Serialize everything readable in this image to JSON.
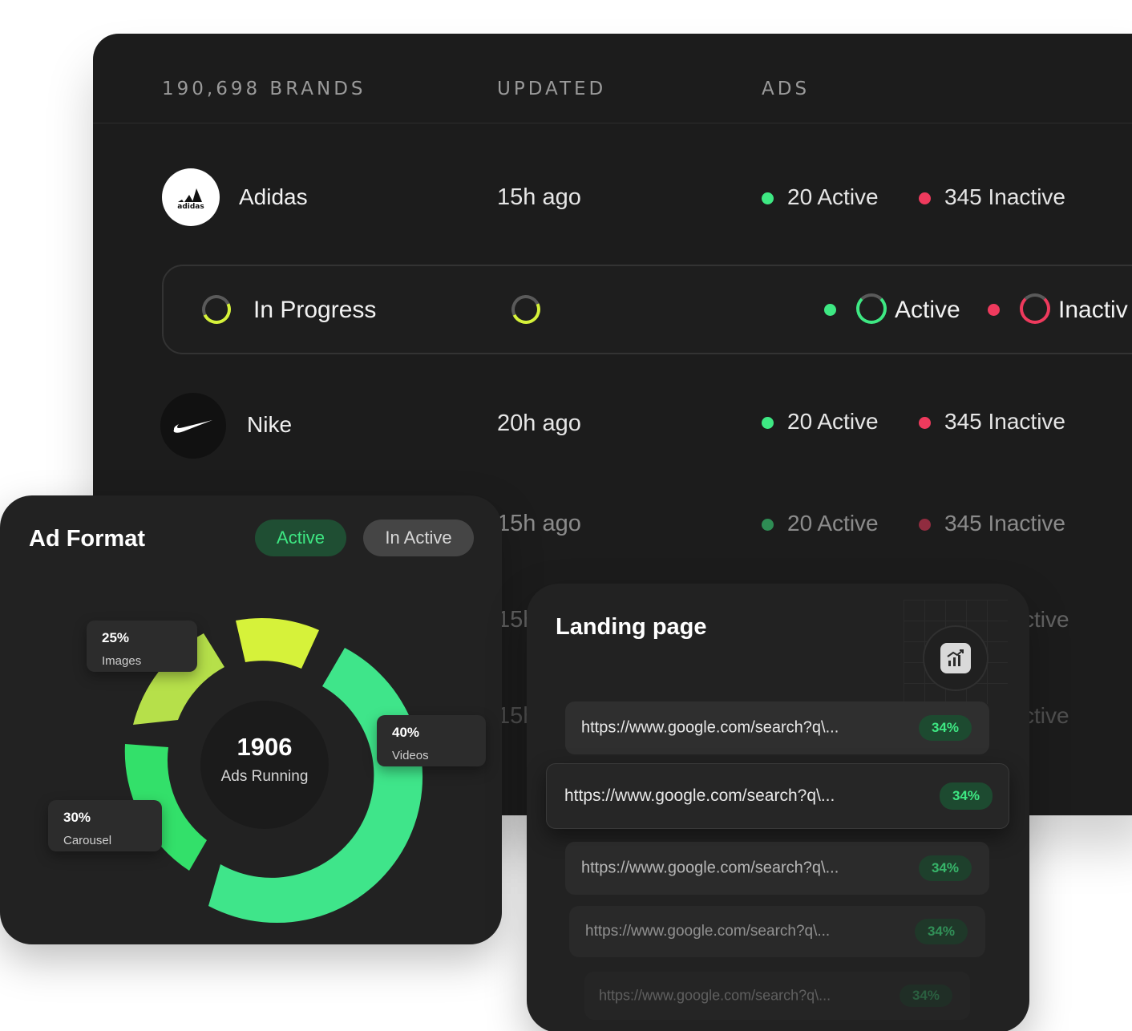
{
  "table": {
    "headers": {
      "brands": "190,698 BRANDS",
      "updated": "UPDATED",
      "ads": "ADS"
    },
    "rows": [
      {
        "brand": "Adidas",
        "logo": "adidas-logo-icon",
        "updated": "15h ago",
        "active": "20 Active",
        "inactive": "345 Inactive"
      },
      {
        "brand": "Nike",
        "logo": "nike-swoosh-icon",
        "updated": "20h ago",
        "active": "20 Active",
        "inactive": "345 Inactive"
      },
      {
        "brand": "",
        "updated": "15h ago",
        "active": "20 Active",
        "inactive": "345 Inactive"
      },
      {
        "updated": "15h",
        "inactive": "ctive"
      },
      {
        "updated": "15h",
        "inactive": "ctive"
      }
    ],
    "progress": {
      "label": "In Progress",
      "active_label": "Active",
      "inactive_label": "Inactiv"
    }
  },
  "ad_format": {
    "title": "Ad Format",
    "filters": {
      "active": "Active",
      "inactive": "In Active"
    },
    "center": {
      "value": "1906",
      "label": "Ads Running"
    },
    "segments": [
      {
        "pct": "25%",
        "label": "Images"
      },
      {
        "pct": "40%",
        "label": "Videos"
      },
      {
        "pct": "30%",
        "label": "Carousel"
      }
    ]
  },
  "landing_page": {
    "title": "Landing page",
    "icon": "chart-icon",
    "urls": [
      {
        "url": "https://www.google.com/search?q\\...",
        "pct": "34%"
      },
      {
        "url": "https://www.google.com/search?q\\...",
        "pct": "34%"
      },
      {
        "url": "https://www.google.com/search?q\\...",
        "pct": "34%"
      },
      {
        "url": "https://www.google.com/search?q\\...",
        "pct": "34%"
      },
      {
        "url": "https://www.google.com/search?q\\...",
        "pct": "34%"
      }
    ]
  },
  "colors": {
    "panel": "#1c1c1c",
    "card": "#222222",
    "green": "#3ee883",
    "red": "#ef3a5d",
    "lime": "#d6f23a",
    "lime_soft": "#b6e04a"
  }
}
